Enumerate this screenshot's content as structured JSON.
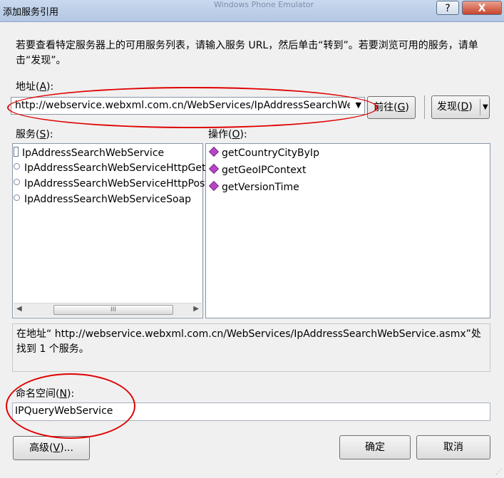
{
  "window": {
    "title": "添加服务引用",
    "background_window_title": "Windows Phone Emulator"
  },
  "titlebar": {
    "help_label": "?",
    "close_label": "X"
  },
  "description": "若要查看特定服务器上的可用服务列表，请输入服务 URL，然后单击“转到”。若要浏览可用的服务，请单击“发现”。",
  "address": {
    "label_text": "地址(",
    "label_key": "A",
    "label_end": "):",
    "value": "http://webservice.webxml.com.cn/WebServices/IpAddressSearchWebS",
    "dropdown_glyph": "▼"
  },
  "go_button": {
    "text": "前往(",
    "key": "G",
    "end": ")"
  },
  "discover_button": {
    "text": "发现(",
    "key": "D",
    "end": ")",
    "arrow": "▼"
  },
  "services": {
    "label_text": "服务(",
    "label_key": "S",
    "label_end": "):",
    "root": "IpAddressSearchWebService",
    "items": [
      "IpAddressSearchWebServiceHttpGet",
      "IpAddressSearchWebServiceHttpPost",
      "IpAddressSearchWebServiceSoap"
    ],
    "scroll_left": "◀",
    "scroll_right": "▶",
    "scroll_grip": "III"
  },
  "operations": {
    "label_text": "操作(",
    "label_key": "O",
    "label_end": "):",
    "items": [
      "getCountryCityByIp",
      "getGeoIPContext",
      "getVersionTime"
    ]
  },
  "status_text": "在地址“ http://webservice.webxml.com.cn/WebServices/IpAddressSearchWebService.asmx”处找到 1 个服务。",
  "namespace": {
    "label_text": "命名空间(",
    "label_key": "N",
    "label_end": "):",
    "value": "IPQueryWebService"
  },
  "advanced_button": {
    "text": "高级(",
    "key": "V",
    "end": ")..."
  },
  "ok_button": {
    "label": "确定"
  },
  "cancel_button": {
    "label": "取消"
  },
  "annotation_color": "#e00000"
}
